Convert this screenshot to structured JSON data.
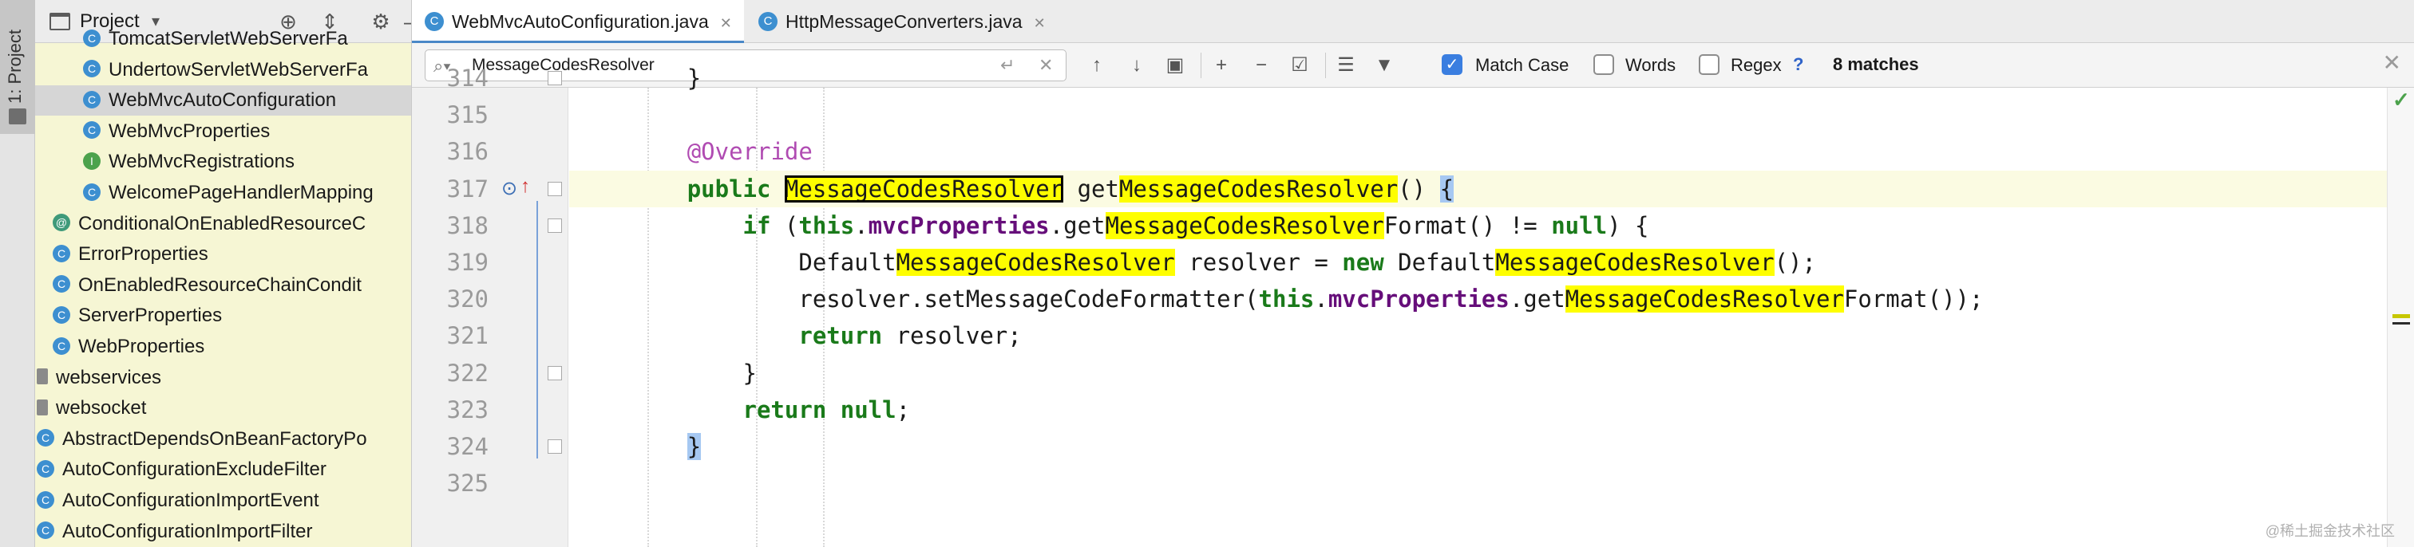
{
  "toolstrip": {
    "project_tab_label": "1: Project"
  },
  "project_panel": {
    "title": "Project",
    "tree": [
      {
        "label": "TomcatServletWebServerFa",
        "icon": "class",
        "indent": 1,
        "selected": false
      },
      {
        "label": "UndertowServletWebServerFa",
        "icon": "class",
        "indent": 1,
        "selected": false
      },
      {
        "label": "WebMvcAutoConfiguration",
        "icon": "class",
        "indent": 1,
        "selected": true
      },
      {
        "label": "WebMvcProperties",
        "icon": "class",
        "indent": 1,
        "selected": false
      },
      {
        "label": "WebMvcRegistrations",
        "icon": "interface",
        "indent": 1,
        "selected": false
      },
      {
        "label": "WelcomePageHandlerMapping",
        "icon": "class",
        "indent": 1,
        "selected": false
      },
      {
        "label": "ConditionalOnEnabledResourceC",
        "icon": "annotation",
        "indent": 0,
        "selected": false
      },
      {
        "label": "ErrorProperties",
        "icon": "class",
        "indent": 0,
        "selected": false
      },
      {
        "label": "OnEnabledResourceChainCondit",
        "icon": "class",
        "indent": 0,
        "selected": false
      },
      {
        "label": "ServerProperties",
        "icon": "class",
        "indent": 0,
        "selected": false
      },
      {
        "label": "WebProperties",
        "icon": "class",
        "indent": 0,
        "selected": false
      },
      {
        "label": "webservices",
        "icon": "package",
        "indent": -1,
        "selected": false
      },
      {
        "label": "websocket",
        "icon": "package",
        "indent": -1,
        "selected": false
      },
      {
        "label": "AbstractDependsOnBeanFactoryPo",
        "icon": "class",
        "indent": -1,
        "selected": false
      },
      {
        "label": "AutoConfigurationExcludeFilter",
        "icon": "class",
        "indent": -1,
        "selected": false
      },
      {
        "label": "AutoConfigurationImportEvent",
        "icon": "class",
        "indent": -1,
        "selected": false
      },
      {
        "label": "AutoConfigurationImportFilter",
        "icon": "class",
        "indent": -1,
        "selected": false
      }
    ]
  },
  "tabs": [
    {
      "label": "WebMvcAutoConfiguration.java",
      "active": true
    },
    {
      "label": "HttpMessageConverters.java",
      "active": false
    }
  ],
  "find": {
    "query": "MessageCodesResolver",
    "match_case_label": "Match Case",
    "match_case_checked": true,
    "words_label": "Words",
    "words_checked": false,
    "regex_label": "Regex",
    "regex_checked": false,
    "help": "?",
    "matches": "8 matches"
  },
  "editor": {
    "lines": [
      {
        "num": "314",
        "tokens": [
          [
            "pad",
            "        "
          ],
          [
            "txt",
            "}"
          ]
        ]
      },
      {
        "num": "315",
        "tokens": []
      },
      {
        "num": "316",
        "tokens": [
          [
            "pad",
            "        "
          ],
          [
            "ann",
            "@Override"
          ]
        ]
      },
      {
        "num": "317",
        "tokens": [
          [
            "pad",
            "        "
          ],
          [
            "kw2",
            "public"
          ],
          [
            "txt",
            " "
          ],
          [
            "hlcur",
            "MessageCodesResolver"
          ],
          [
            "txt",
            " get"
          ],
          [
            "hl",
            "MessageCodesResolver"
          ],
          [
            "txt",
            "() "
          ],
          [
            "brace",
            "{"
          ]
        ]
      },
      {
        "num": "318",
        "tokens": [
          [
            "pad",
            "            "
          ],
          [
            "kw2",
            "if"
          ],
          [
            "txt",
            " ("
          ],
          [
            "kw2",
            "this"
          ],
          [
            "txt",
            "."
          ],
          [
            "fld",
            "mvcProperties"
          ],
          [
            "txt",
            ".get"
          ],
          [
            "hl",
            "MessageCodesResolver"
          ],
          [
            "txt",
            "Format() != "
          ],
          [
            "kw2",
            "null"
          ],
          [
            "txt",
            ") {"
          ]
        ]
      },
      {
        "num": "319",
        "tokens": [
          [
            "pad",
            "                "
          ],
          [
            "txt",
            "Default"
          ],
          [
            "hl",
            "MessageCodesResolver"
          ],
          [
            "txt",
            " resolver = "
          ],
          [
            "kw2",
            "new"
          ],
          [
            "txt",
            " Default"
          ],
          [
            "hl",
            "MessageCodesResolver"
          ],
          [
            "txt",
            "();"
          ]
        ]
      },
      {
        "num": "320",
        "tokens": [
          [
            "pad",
            "                "
          ],
          [
            "txt",
            "resolver.setMessageCodeFormatter("
          ],
          [
            "kw2",
            "this"
          ],
          [
            "txt",
            "."
          ],
          [
            "fld",
            "mvcProperties"
          ],
          [
            "txt",
            ".get"
          ],
          [
            "hl",
            "MessageCodesResolver"
          ],
          [
            "txt",
            "Format());"
          ]
        ]
      },
      {
        "num": "321",
        "tokens": [
          [
            "pad",
            "                "
          ],
          [
            "kw2",
            "return"
          ],
          [
            "txt",
            " resolver;"
          ]
        ]
      },
      {
        "num": "322",
        "tokens": [
          [
            "pad",
            "            "
          ],
          [
            "txt",
            "}"
          ]
        ]
      },
      {
        "num": "323",
        "tokens": [
          [
            "pad",
            "            "
          ],
          [
            "kw2",
            "return"
          ],
          [
            "txt",
            " "
          ],
          [
            "kw2",
            "null"
          ],
          [
            "txt",
            ";"
          ]
        ]
      },
      {
        "num": "324",
        "tokens": [
          [
            "pad",
            "        "
          ],
          [
            "brace",
            "}"
          ]
        ]
      },
      {
        "num": "325",
        "tokens": []
      }
    ]
  },
  "colors": {
    "accent": "#4a88c7",
    "highlight": "#fefe00",
    "keyword": "#1a7a1a"
  },
  "watermark": "@稀土掘金技术社区"
}
